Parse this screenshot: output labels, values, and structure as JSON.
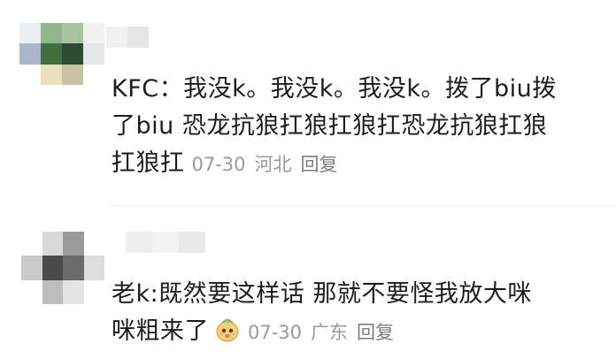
{
  "comments": [
    {
      "text_line1": "KFC：我没k。我没k。我没k。拨了biu拨",
      "text_line2": "了biu 恐龙抗狼扛狼扛狼扛恐龙抗狼扛狼",
      "text_line3": "扛狼扛",
      "date": "07-30",
      "location": "河北",
      "reply": "回复"
    },
    {
      "text_line1": "老k:既然要这样话 那就不要怪我放大咪",
      "text_line2": "咪粗来了",
      "emoji_icon": "cute-face-emoji-icon",
      "date": "07-30",
      "location": "广东",
      "reply": "回复"
    }
  ],
  "colors": {
    "text": "#1d1d1d",
    "meta": "#9a9a9a",
    "divider": "#ececec"
  }
}
